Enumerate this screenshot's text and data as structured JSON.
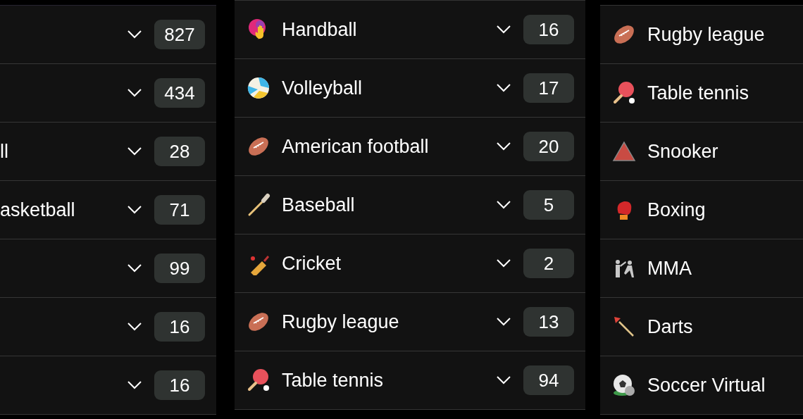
{
  "columns": [
    {
      "items": [
        {
          "count": "827"
        },
        {
          "count": "434"
        },
        {
          "label": "ll",
          "count": "28"
        },
        {
          "label": "asketball",
          "count": "71"
        },
        {
          "count": "99"
        },
        {
          "count": "16"
        },
        {
          "count": "16"
        }
      ]
    },
    {
      "items": [
        {
          "label": "Handball",
          "count": "16"
        },
        {
          "label": "Volleyball",
          "count": "17"
        },
        {
          "label": "American football",
          "count": "20"
        },
        {
          "label": "Baseball",
          "count": "5"
        },
        {
          "label": "Cricket",
          "count": "2"
        },
        {
          "label": "Rugby league",
          "count": "13"
        },
        {
          "label": "Table tennis",
          "count": "94"
        }
      ]
    },
    {
      "items": [
        {
          "label": "Rugby league"
        },
        {
          "label": "Table tennis"
        },
        {
          "label": "Snooker"
        },
        {
          "label": "Boxing"
        },
        {
          "label": "MMA"
        },
        {
          "label": "Darts"
        },
        {
          "label": "Soccer Virtual"
        }
      ]
    }
  ]
}
